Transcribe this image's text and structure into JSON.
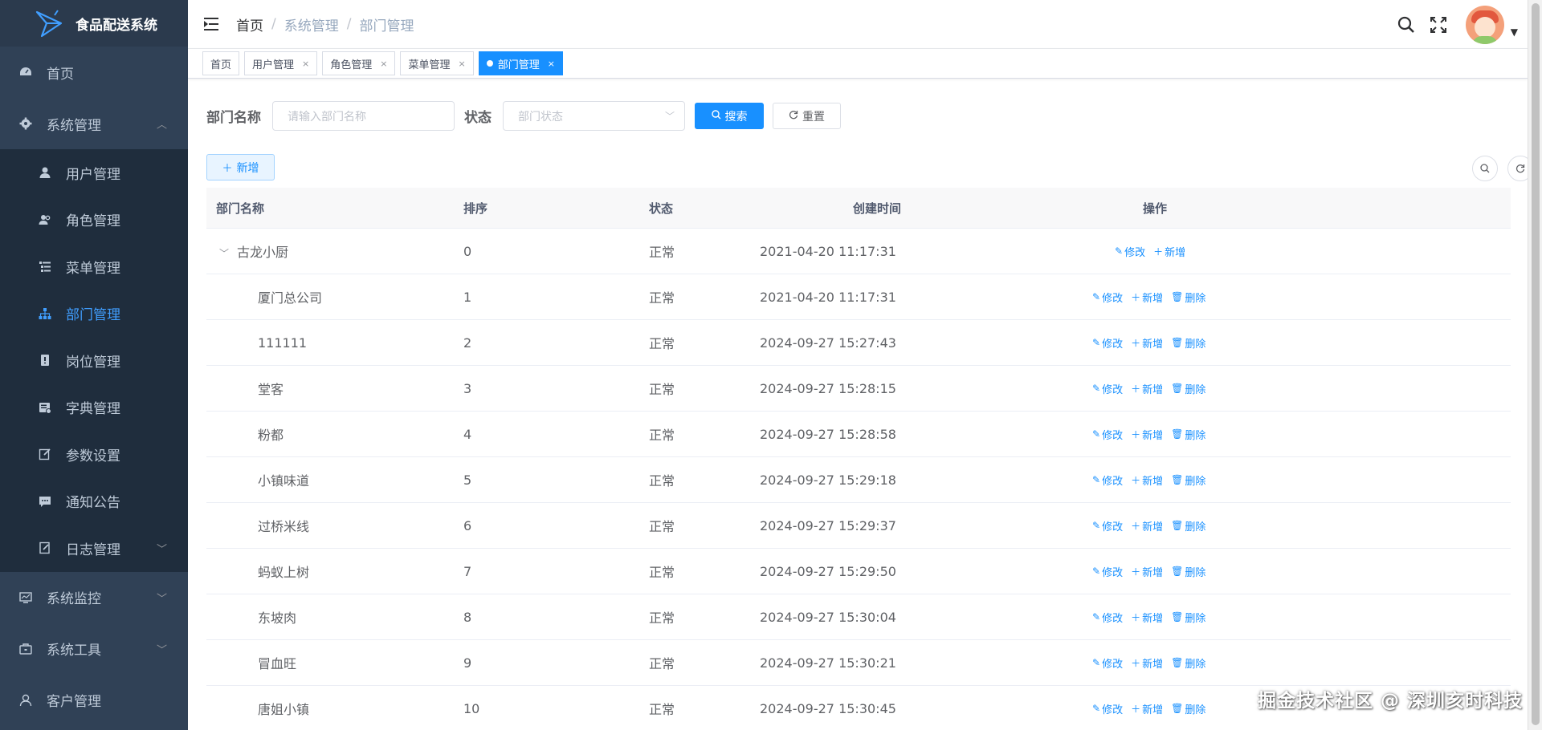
{
  "app": {
    "title": "食品配送系统"
  },
  "sidebar": {
    "home": "首页",
    "system": "系统管理",
    "system_items": [
      {
        "label": "用户管理",
        "icon": "user-icon"
      },
      {
        "label": "角色管理",
        "icon": "peoples-icon"
      },
      {
        "label": "菜单管理",
        "icon": "tree-table-icon"
      },
      {
        "label": "部门管理",
        "icon": "tree-icon",
        "active": true
      },
      {
        "label": "岗位管理",
        "icon": "post-icon"
      },
      {
        "label": "字典管理",
        "icon": "dict-icon"
      },
      {
        "label": "参数设置",
        "icon": "edit-icon"
      },
      {
        "label": "通知公告",
        "icon": "message-icon"
      },
      {
        "label": "日志管理",
        "icon": "log-icon"
      }
    ],
    "monitor": "系统监控",
    "tool": "系统工具",
    "customer": "客户管理"
  },
  "breadcrumb": [
    "首页",
    "系统管理",
    "部门管理"
  ],
  "tags": [
    {
      "label": "首页",
      "closable": false,
      "active": false
    },
    {
      "label": "用户管理",
      "closable": true,
      "active": false
    },
    {
      "label": "角色管理",
      "closable": true,
      "active": false
    },
    {
      "label": "菜单管理",
      "closable": true,
      "active": false
    },
    {
      "label": "部门管理",
      "closable": true,
      "active": true
    }
  ],
  "search": {
    "dept_label": "部门名称",
    "dept_placeholder": "请输入部门名称",
    "status_label": "状态",
    "status_placeholder": "部门状态",
    "search_button": "搜索",
    "reset_button": "重置",
    "add_button": "新增"
  },
  "table": {
    "headers": {
      "name": "部门名称",
      "order": "排序",
      "status": "状态",
      "time": "创建时间",
      "ops": "操作"
    },
    "root": {
      "name": "古龙小厨",
      "order": "0",
      "status": "正常",
      "time": "2021-04-20 11:17:31"
    },
    "rows": [
      {
        "name": "厦门总公司",
        "order": "1",
        "status": "正常",
        "time": "2021-04-20 11:17:31"
      },
      {
        "name": "111111",
        "order": "2",
        "status": "正常",
        "time": "2024-09-27 15:27:43"
      },
      {
        "name": "堂客",
        "order": "3",
        "status": "正常",
        "time": "2024-09-27 15:28:15"
      },
      {
        "name": "粉都",
        "order": "4",
        "status": "正常",
        "time": "2024-09-27 15:28:58"
      },
      {
        "name": "小镇味道",
        "order": "5",
        "status": "正常",
        "time": "2024-09-27 15:29:18"
      },
      {
        "name": "过桥米线",
        "order": "6",
        "status": "正常",
        "time": "2024-09-27 15:29:37"
      },
      {
        "name": "蚂蚁上树",
        "order": "7",
        "status": "正常",
        "time": "2024-09-27 15:29:50"
      },
      {
        "name": "东坡肉",
        "order": "8",
        "status": "正常",
        "time": "2024-09-27 15:30:04"
      },
      {
        "name": "冒血旺",
        "order": "9",
        "status": "正常",
        "time": "2024-09-27 15:30:21"
      },
      {
        "name": "唐姐小镇",
        "order": "10",
        "status": "正常",
        "time": "2024-09-27 15:30:45"
      }
    ],
    "ops": {
      "edit": "修改",
      "add": "新增",
      "delete": "删除"
    }
  },
  "watermark": "掘金技术社区 @ 深圳亥时科技",
  "colors": {
    "sidebar_bg": "#304156",
    "accent": "#1890ff",
    "active_menu": "#409eff"
  }
}
